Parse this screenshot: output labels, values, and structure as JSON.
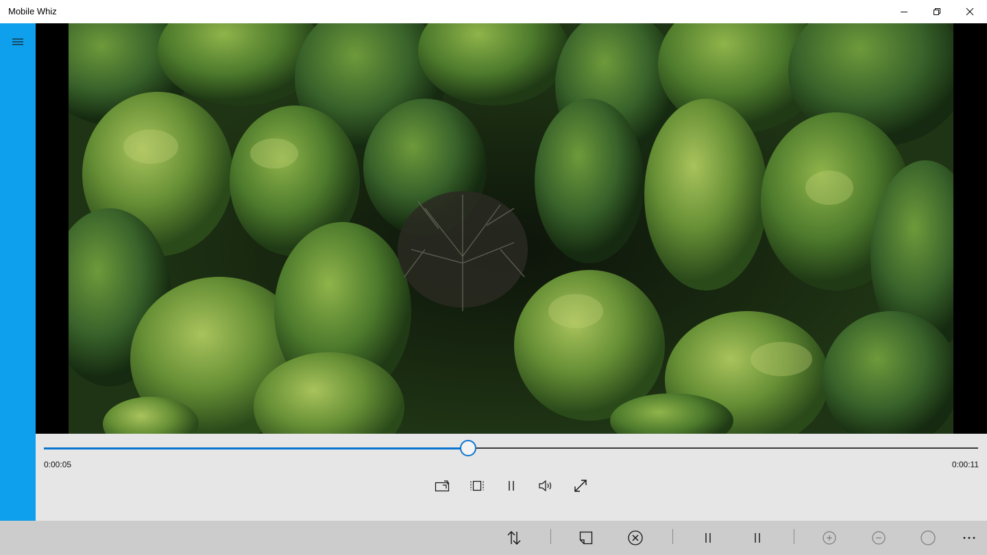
{
  "window": {
    "title": "Mobile Whiz"
  },
  "player": {
    "current_time": "0:00:05",
    "total_time": "0:00:11",
    "progress": 0.4545
  },
  "colors": {
    "accent_bar": "#0ea0ec",
    "seek_accent": "#0b74d0",
    "controls_bg": "#e6e6e6",
    "command_bar_bg": "#cccccc"
  },
  "icons": {
    "hamburger": "hamburger-menu-icon",
    "cast": "cast-icon",
    "aspect": "aspect-ratio-icon",
    "pause": "pause-icon",
    "volume": "volume-icon",
    "fullscreen": "fullscreen-icon",
    "sort": "sort-icon",
    "note": "note-icon",
    "close_circle": "close-circle-icon",
    "zoom_in": "zoom-in-icon",
    "zoom_out": "zoom-out-icon",
    "circle": "circle-icon",
    "more": "more-icon"
  }
}
